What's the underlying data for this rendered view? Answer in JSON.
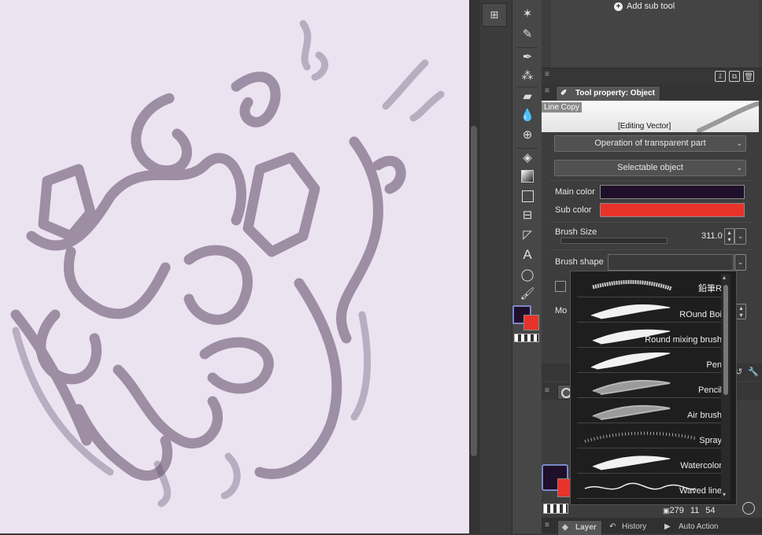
{
  "canvas": {
    "background": "#ece3f1",
    "stroke_color": "#5d4a66"
  },
  "subtool": {
    "add_label": "Add sub tool"
  },
  "tool_property": {
    "title": "Tool property: Object",
    "preview_label": "Line Copy",
    "editing_label": "[Editing Vector]",
    "transparent_dropdown": "Operation of transparent part",
    "selectable_dropdown": "Selectable object",
    "main_color_label": "Main color",
    "sub_color_label": "Sub color",
    "main_color": "#1f0f2a",
    "sub_color": "#e8332a",
    "brush_size_label": "Brush Size",
    "brush_size_value": "311.0",
    "brush_shape_label": "Brush shape",
    "mode_label_partial": "Mo"
  },
  "brush_popup": {
    "items": [
      {
        "label": "鉛筆R",
        "icon": "pencil-stroke-icon"
      },
      {
        "label": "ROund Boi",
        "icon": "round-brush-stroke-icon"
      },
      {
        "label": "Round mixing brush",
        "icon": "mixing-brush-stroke-icon"
      },
      {
        "label": "Pen",
        "icon": "pen-stroke-icon"
      },
      {
        "label": "Pencil",
        "icon": "pencil-stroke-icon"
      },
      {
        "label": "Air brush",
        "icon": "airbrush-stroke-icon"
      },
      {
        "label": "Spray",
        "icon": "spray-stroke-icon"
      },
      {
        "label": "Watercolor",
        "icon": "watercolor-stroke-icon"
      },
      {
        "label": "Waved line",
        "icon": "waved-line-stroke-icon"
      }
    ]
  },
  "status": {
    "count_a": "279",
    "count_b": "11",
    "count_c": "54"
  },
  "bottom_tabs": {
    "layer": "Layer",
    "history": "History",
    "auto_action": "Auto Action"
  }
}
